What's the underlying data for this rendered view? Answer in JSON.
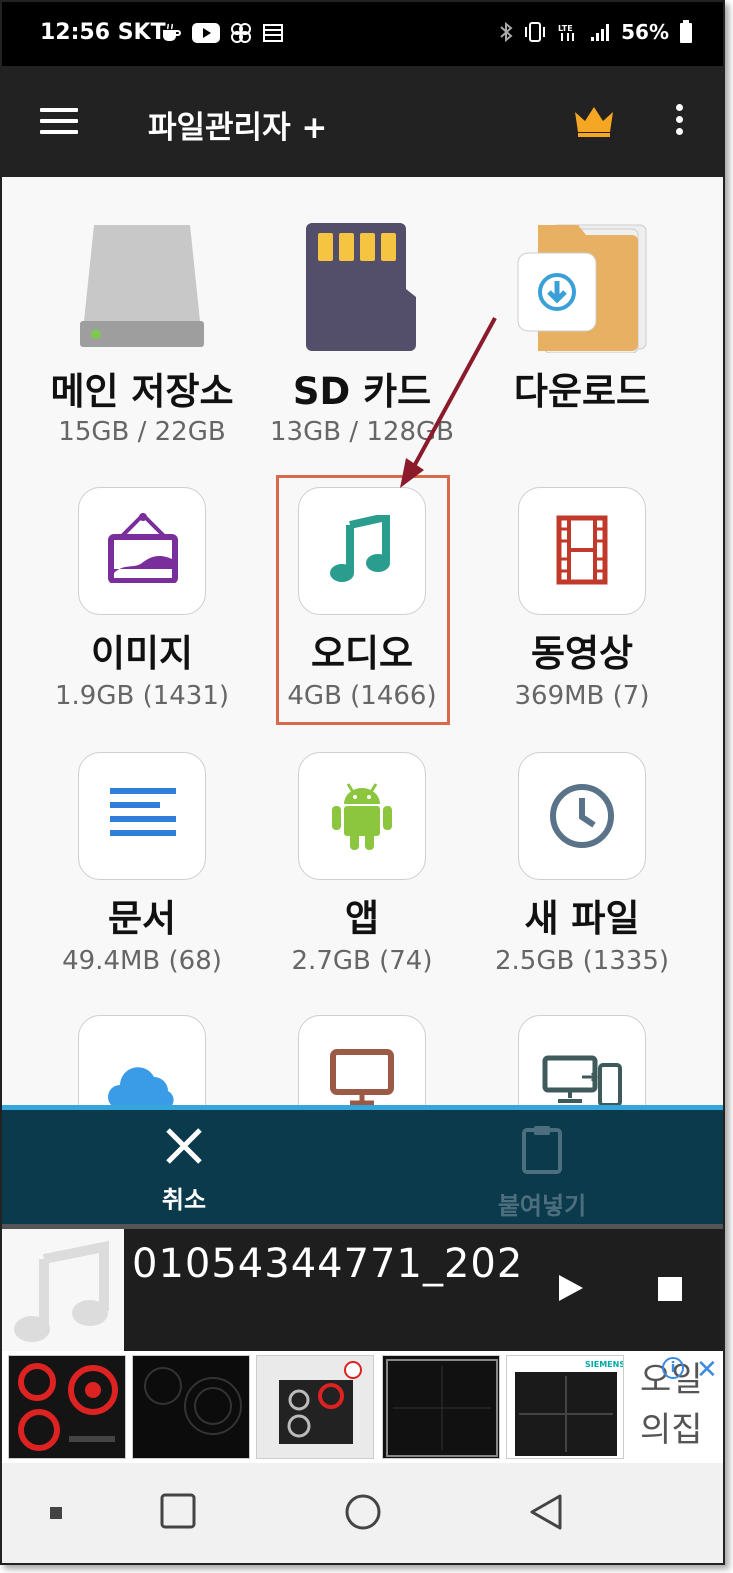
{
  "status_bar": {
    "time": "12:56 SKT",
    "battery": "56%",
    "network": "LTE"
  },
  "app_bar": {
    "title": "파일관리자 +"
  },
  "categories": [
    {
      "label": "메인 저장소",
      "sub": "15GB / 22GB",
      "icon": "hard-drive-icon"
    },
    {
      "label": "SD 카드",
      "sub": "13GB / 128GB",
      "icon": "sd-card-icon"
    },
    {
      "label": "다운로드",
      "sub": "",
      "icon": "download-folder-icon"
    },
    {
      "label": "이미지",
      "sub": "1.9GB (1431)",
      "icon": "image-icon"
    },
    {
      "label": "오디오",
      "sub": "4GB (1466)",
      "icon": "music-note-icon"
    },
    {
      "label": "동영상",
      "sub": "369MB (7)",
      "icon": "film-icon"
    },
    {
      "label": "문서",
      "sub": "49.4MB (68)",
      "icon": "document-icon"
    },
    {
      "label": "앱",
      "sub": "2.7GB (74)",
      "icon": "android-icon"
    },
    {
      "label": "새 파일",
      "sub": "2.5GB (1335)",
      "icon": "clock-icon"
    }
  ],
  "action_bar": {
    "cancel_label": "취소",
    "paste_label": "붙여넣기"
  },
  "player": {
    "track": "01054344771_202"
  },
  "ad": {
    "brand": "SIEMENS",
    "text_line1": "오일",
    "text_line2": "의집"
  },
  "colors": {
    "app_bar": "#222222",
    "action_bar": "#0b3a4d",
    "accent_blue": "#35a6db",
    "highlight": "#d86a4a",
    "arrow": "#8b1a2b",
    "crown": "#f5a623"
  }
}
